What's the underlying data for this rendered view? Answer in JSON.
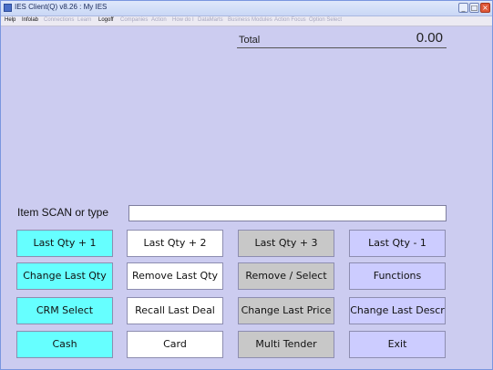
{
  "window": {
    "title": "IES Client(Q) v8.26 : My IES",
    "buttons": {
      "minimize": "_",
      "maximize": "□",
      "close": "×"
    }
  },
  "menu": [
    {
      "label": "Help",
      "enabled": true
    },
    {
      "label": "Infolab",
      "enabled": true
    },
    {
      "label": "Connections",
      "enabled": false
    },
    {
      "label": "Learn",
      "enabled": false
    },
    {
      "label": "Logoff",
      "enabled": true
    },
    {
      "label": "Companies",
      "enabled": false
    },
    {
      "label": "Action",
      "enabled": false
    },
    {
      "label": "How do I",
      "enabled": false
    },
    {
      "label": "DataMarts",
      "enabled": false
    },
    {
      "label": "Business Modules",
      "enabled": false
    },
    {
      "label": "Action Focus",
      "enabled": false
    },
    {
      "label": "Option Select",
      "enabled": false
    }
  ],
  "total": {
    "label": "Total",
    "value": "0.00"
  },
  "scan": {
    "label": "Item SCAN or type",
    "value": ""
  },
  "buttons": {
    "last_qty_plus_1": "Last Qty + 1",
    "last_qty_plus_2": "Last Qty + 2",
    "last_qty_plus_3": "Last Qty + 3",
    "last_qty_minus_1": "Last Qty - 1",
    "change_last_qty": "Change Last Qty",
    "remove_last_qty": "Remove Last Qty",
    "remove_select": "Remove / Select",
    "functions": "Functions",
    "crm_select": "CRM Select",
    "recall_last_deal": "Recall Last Deal",
    "change_last_price": "Change Last Price",
    "change_last_descr": "Change Last Descr",
    "cash": "Cash",
    "card": "Card",
    "multi_tender": "Multi Tender",
    "exit": "Exit"
  },
  "colors": {
    "background": "#ccccf0",
    "cyan_button": "#66ffff",
    "white_button": "#ffffff",
    "gray_button": "#c8c8c8",
    "lavender_button": "#ccccff"
  }
}
